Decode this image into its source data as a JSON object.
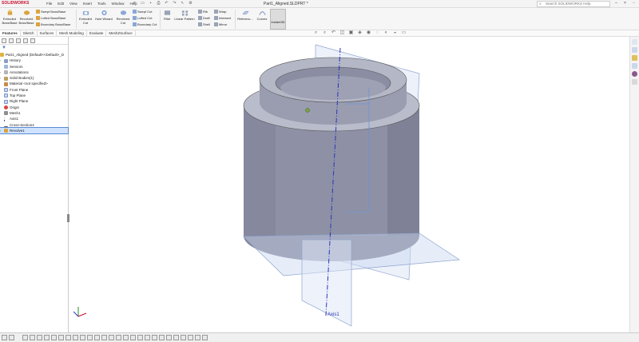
{
  "app": {
    "logo_text": "SOLIDWORKS",
    "doc_title": "Part1_Aligned.SLDPRT *"
  },
  "menus": [
    "File",
    "Edit",
    "View",
    "Insert",
    "Tools",
    "Window",
    "Help"
  ],
  "search": {
    "placeholder": "Search SOLIDWORKS Help"
  },
  "ribbon": {
    "extruded_boss": "Extruded Boss/Base",
    "revolved_boss": "Revolved Boss/Base",
    "swept_boss": "Swept Boss/Base",
    "lofted_boss": "Lofted Boss/Base",
    "boundary_boss": "Boundary Boss/Base",
    "extruded_cut": "Extruded Cut",
    "hole_wizard": "Hole Wizard",
    "revolved_cut": "Revolved Cut",
    "swept_cut": "Swept Cut",
    "lofted_cut": "Lofted Cut",
    "boundary_cut": "Boundary Cut",
    "fillet": "Fillet",
    "linear_pattern": "Linear Pattern",
    "rib": "Rib",
    "draft": "Draft",
    "shell": "Shell",
    "wrap": "Wrap",
    "intersect": "Intersect",
    "mirror": "Mirror",
    "reference": "Referenc...",
    "curves": "Curves",
    "instant3d": "Instant3D"
  },
  "tabs": [
    "Features",
    "Sketch",
    "Surfaces",
    "Mesh Modeling",
    "Evaluate",
    "MeshZSurface"
  ],
  "tree": {
    "root": "Part1_Aligned (Default<<Default>_D",
    "items": [
      "History",
      "Sensors",
      "Annotations",
      "Solid Bodies(1)",
      "Material <not specified>",
      "Front Plane",
      "Top Plane",
      "Right Plane",
      "Origin",
      "Mesh1",
      "Axis1",
      "Cross-Section4",
      "Revolve1"
    ]
  },
  "viewport": {
    "axis_label": "Axis1"
  },
  "colors": {
    "accent": "#c8102e",
    "selection": "#cfe3ff",
    "model_side": "#8c8fa3",
    "model_top": "#b9bccb",
    "plane": "#c9d6f0",
    "axis": "#2b35b8"
  }
}
